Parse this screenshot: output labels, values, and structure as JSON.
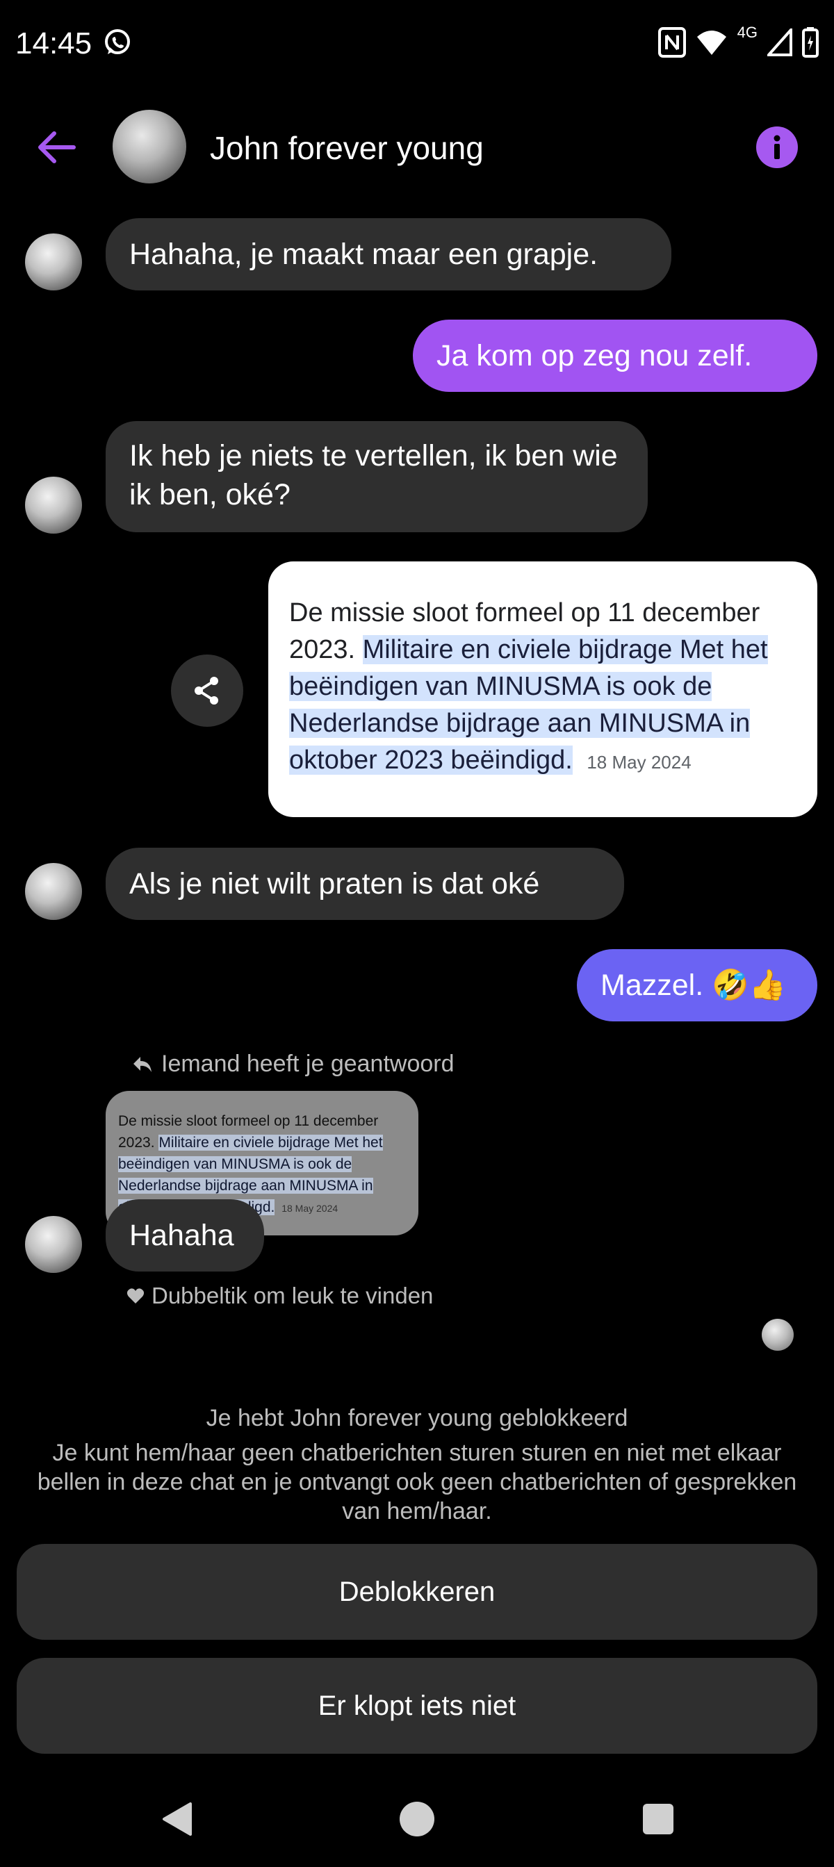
{
  "status_bar": {
    "time": "14:45",
    "network": "4G",
    "icons": [
      "whatsapp-icon",
      "nfc-icon",
      "wifi-icon",
      "signal-icon",
      "battery-icon"
    ]
  },
  "header": {
    "contact_name": "John forever young",
    "back_icon": "arrow-left-icon",
    "info_icon": "info-icon",
    "accent_color": "#a659f0"
  },
  "messages": [
    {
      "from": "them",
      "text": "Hahaha, je maakt maar een grapje."
    },
    {
      "from": "me",
      "text": "Ja kom op zeg nou zelf.",
      "color": "#a154f2"
    },
    {
      "from": "them",
      "text": "Ik heb je niets te vertellen, ik ben wie ik ben, oké?"
    },
    {
      "from": "me",
      "type": "shared_snippet",
      "lead": "De missie sloot formeel op 11 december 2023.",
      "highlight": "Militaire en civiele bijdrage Met het beëindigen van MINUSMA is ook de Nederlandse bijdrage aan MINUSMA in oktober 2023 beëindigd.",
      "date": "18 May 2024"
    },
    {
      "from": "them",
      "text": "Als je niet wilt praten is dat oké"
    },
    {
      "from": "me",
      "text": "Mazzel. 🤣👍",
      "color": "#6b63f3"
    },
    {
      "from": "them",
      "type": "reply",
      "reply_label": "Iemand heeft je geantwoord",
      "text": "Hahaha",
      "like_hint": "Dubbeltik om leuk te vinden"
    }
  ],
  "blocked": {
    "title": "Je hebt John forever young geblokkeerd",
    "description": "Je kunt hem/haar geen chatberichten sturen sturen en niet met elkaar bellen in deze chat en je ontvangt ook geen chatberichten of gesprekken van hem/haar.",
    "unblock_label": "Deblokkeren",
    "report_label": "Er klopt iets niet"
  },
  "nav": {
    "back": "nav-back-icon",
    "home": "nav-home-icon",
    "recent": "nav-recent-icon"
  }
}
